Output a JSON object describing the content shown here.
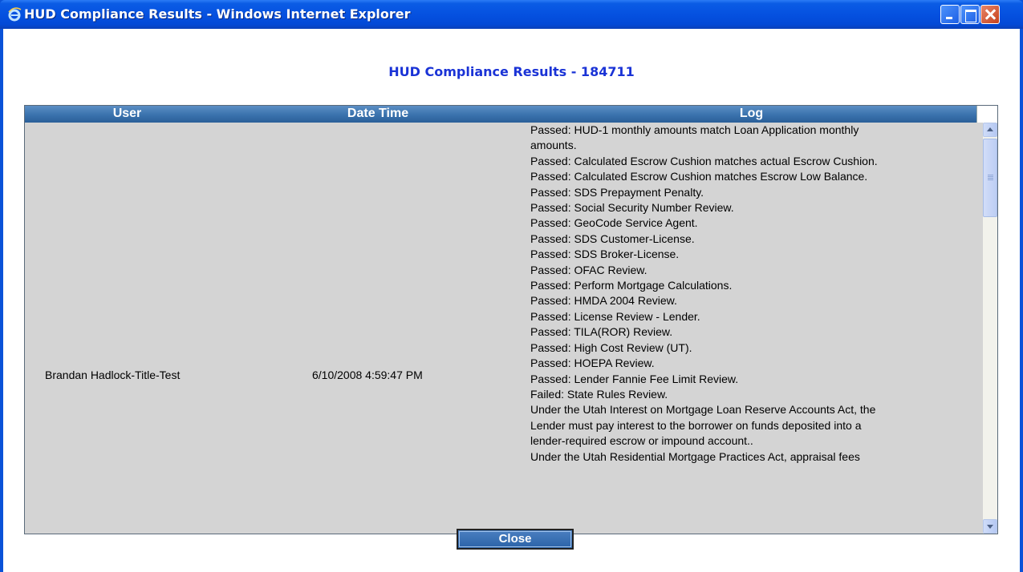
{
  "window": {
    "title": "HUD Compliance Results - Windows Internet Explorer",
    "icon": "ie-icon"
  },
  "page": {
    "heading": "HUD Compliance Results - 184711"
  },
  "table": {
    "columns": [
      "User",
      "Date Time",
      "Log"
    ],
    "row": {
      "user": "Brandan Hadlock-Title-Test",
      "date_time": "6/10/2008 4:59:47 PM",
      "log_lines": [
        "Passed: HUD-1 monthly amounts match Loan Application monthly",
        "amounts.",
        "Passed: Calculated Escrow Cushion matches actual Escrow Cushion.",
        "Passed: Calculated Escrow Cushion matches Escrow Low Balance.",
        "Passed: SDS Prepayment Penalty.",
        "Passed: Social Security Number Review.",
        "Passed: GeoCode Service Agent.",
        "Passed: SDS Customer-License.",
        "Passed: SDS Broker-License.",
        "Passed: OFAC Review.",
        "Passed: Perform Mortgage Calculations.",
        "Passed: HMDA 2004 Review.",
        "Passed: License Review - Lender.",
        "Passed: TILA(ROR) Review.",
        "Passed: High Cost Review (UT).",
        "Passed: HOEPA Review.",
        "Passed: Lender Fannie Fee Limit Review.",
        "Failed: State Rules Review.",
        "Under the Utah Interest on Mortgage Loan Reserve Accounts Act, the",
        "Lender must pay interest to the borrower on funds deposited into a",
        "lender-required escrow or impound account..",
        "Under the Utah Residential Mortgage Practices Act, appraisal fees"
      ]
    }
  },
  "buttons": {
    "close": "Close"
  }
}
